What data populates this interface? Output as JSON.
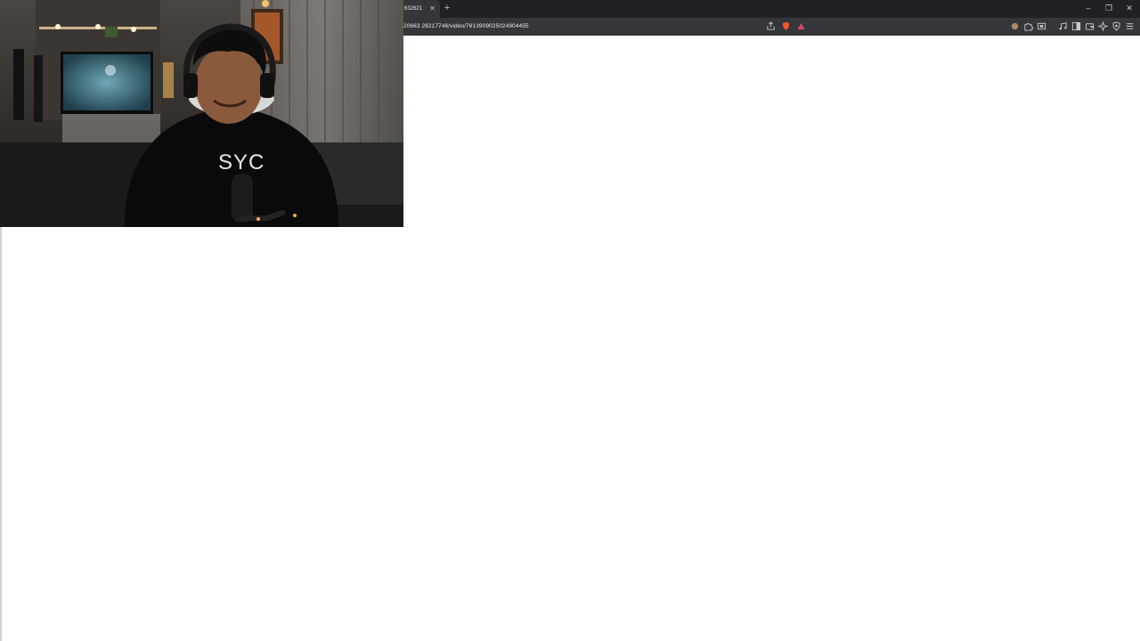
{
  "browser": {
    "tab": {
      "title": "632621"
    },
    "address_bar": {
      "url": "20663 26217746/video/7613909025024904455"
    },
    "colors": {
      "tabstrip": "#202124",
      "toolbar": "#35363a",
      "content": "#ffffff",
      "brave_accent": "#fb542b"
    }
  },
  "icons": {
    "tabstrip": [
      "close-icon",
      "plus-icon",
      "minimize-icon",
      "restore-icon",
      "window-close-icon"
    ],
    "address_bar": [
      "share-icon",
      "brave-shields-icon",
      "brave-rewards-icon"
    ],
    "toolbar": [
      "cookie-extension-icon",
      "puzzle-extensions-icon",
      "screenshot-icon",
      "music-note-icon",
      "sidebar-icon",
      "wallet-icon",
      "leo-ai-icon",
      "vpn-shield-icon",
      "menu-icon"
    ]
  },
  "overlay": {
    "webcam": {
      "hoodie_text": "SYC"
    }
  }
}
